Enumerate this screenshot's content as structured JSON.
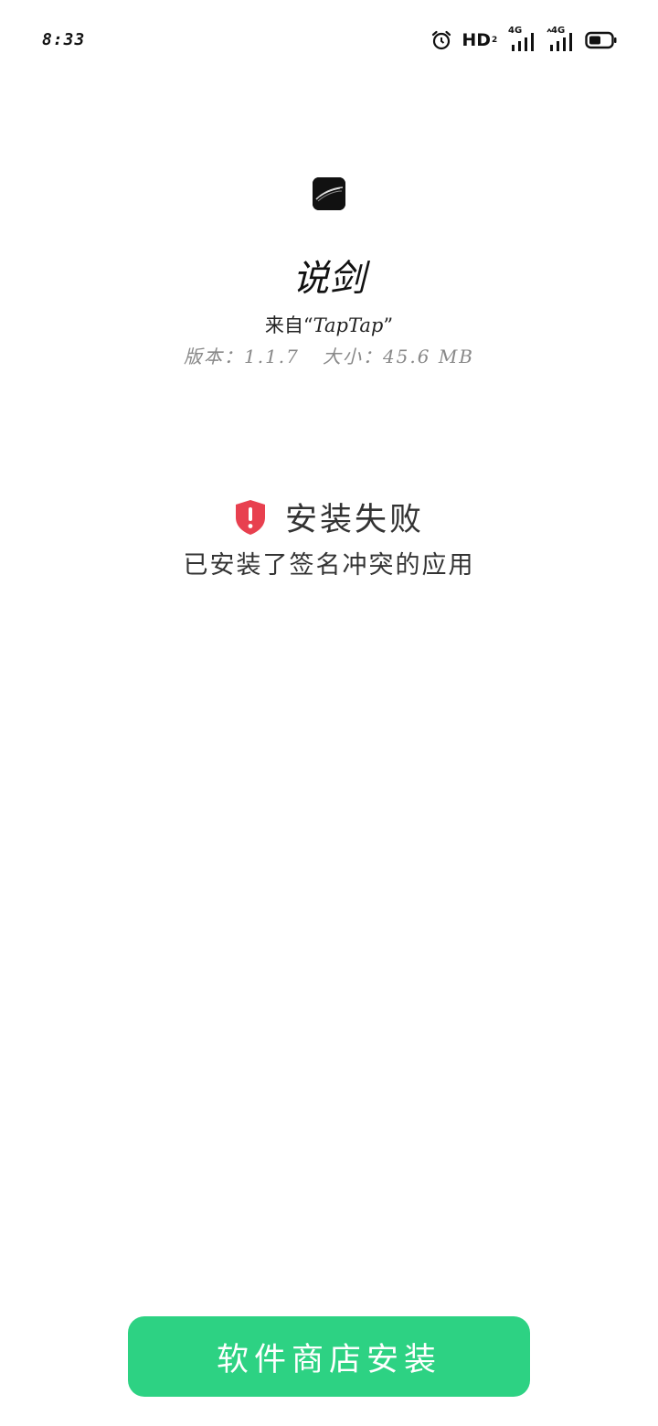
{
  "status_bar": {
    "time": "8:33",
    "hd_label": "HD",
    "hd_sub": "2",
    "sim1_label": "4G",
    "sim2_label": "4G",
    "icons": [
      "alarm-icon",
      "hd-voice-icon",
      "signal-icon",
      "signal-icon",
      "battery-icon"
    ]
  },
  "app": {
    "name": "说剑",
    "source_prefix": "来自“",
    "source_name": "TapTap",
    "source_suffix": "”",
    "meta": "版本：1.1.7   大小：45.6 MB"
  },
  "result": {
    "title": "安装失败",
    "reason": "已安装了签名冲突的应用"
  },
  "actions": {
    "store_install_label": "软件商店安装"
  },
  "colors": {
    "accent": "#2dd283",
    "error": "#e8404f",
    "meta_text": "#888888"
  }
}
